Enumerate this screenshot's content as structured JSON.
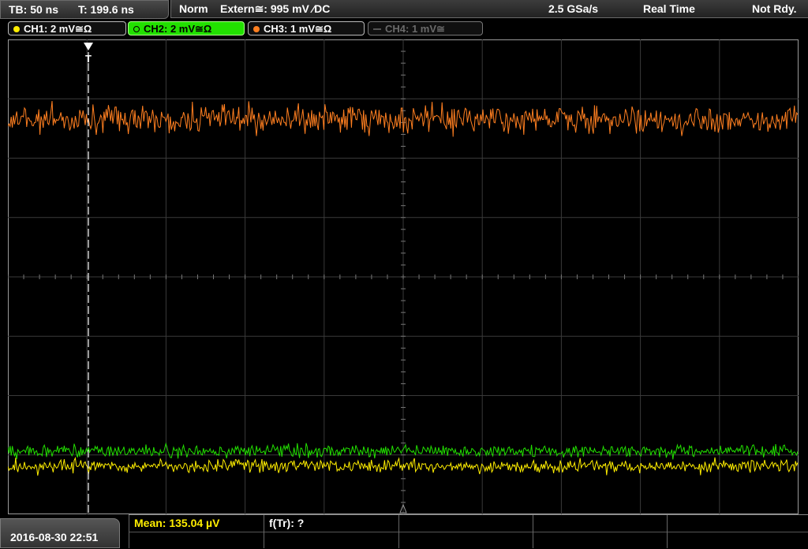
{
  "status": {
    "timebase": "TB: 50 ns",
    "trigger_time": "T: 199.6 ns",
    "trigger_mode": "Norm",
    "trigger_source": "Extern≅: 995 mV ⁄DC",
    "sample_rate": "2.5 GSa/s",
    "acquisition": "Real Time",
    "state": "Not Rdy."
  },
  "channels": [
    {
      "label": "CH1: 2 mV≅Ω",
      "color": "#ffee00",
      "active": true
    },
    {
      "label": "CH2: 2 mV≅Ω",
      "color": "#22e000",
      "active": true
    },
    {
      "label": "CH3: 1 mV≅Ω",
      "color": "#ff7f20",
      "active": true
    },
    {
      "label": "CH4: 1 mV≅",
      "color": "#6a6a6a",
      "active": false
    }
  ],
  "trigger_marker": "T",
  "measurements": {
    "mean": "Mean: 135.04 µV",
    "ftr": "f(Tr): ?"
  },
  "datetime": "2016-08-30 22:51"
}
